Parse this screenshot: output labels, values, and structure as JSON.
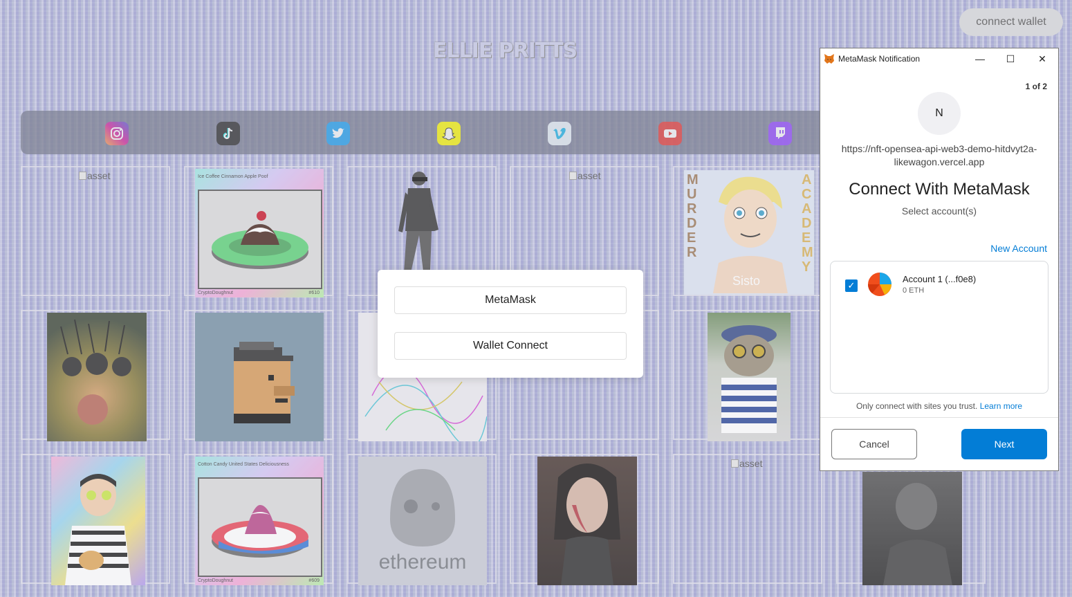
{
  "header": {
    "title": "ELLIE PRITTS",
    "connect_wallet_label": "connect wallet"
  },
  "social_links": [
    {
      "name": "instagram-icon",
      "color": "#d6249f"
    },
    {
      "name": "tiktok-icon",
      "color": "#111111"
    },
    {
      "name": "twitter-icon",
      "color": "#1da1f2"
    },
    {
      "name": "snapchat-icon",
      "color": "#fffc00"
    },
    {
      "name": "vimeo-icon",
      "color": "#1ab7ea"
    },
    {
      "name": "youtube-icon",
      "color": "#ff0000"
    },
    {
      "name": "twitch-icon",
      "color": "#9146ff"
    }
  ],
  "gallery": {
    "broken_alt": "asset",
    "card_610_title": "Ice Coffee Cinnamon Apple Poof",
    "card_610_brand": "CryptoDoughnut",
    "card_610_number": "#610",
    "card_609_title": "Cotton Candy United States Deliciousness",
    "card_609_brand": "CryptoDoughnut",
    "card_609_number": "#609",
    "murder_left": "MURDER",
    "murder_right": "ACADEMY",
    "murder_shirt": "Sisto",
    "ethereum_label": "ethereum"
  },
  "wallet_modal": {
    "metamask_label": "MetaMask",
    "walletconnect_label": "Wallet Connect"
  },
  "metamask": {
    "window_title": "MetaMask Notification",
    "counter": "1 of 2",
    "avatar_letter": "N",
    "origin_line1": "https://nft-opensea-api-web3-demo-hitdvyt2a-",
    "origin_line2": "likewagon.vercel.app",
    "heading": "Connect With MetaMask",
    "subheading": "Select account(s)",
    "new_account_label": "New Account",
    "account_name": "Account 1 (...f0e8)",
    "account_balance": "0 ETH",
    "trust_text": "Only connect with sites you trust.",
    "learn_more": "Learn more",
    "cancel_label": "Cancel",
    "next_label": "Next",
    "accent_color": "#037dd6"
  }
}
